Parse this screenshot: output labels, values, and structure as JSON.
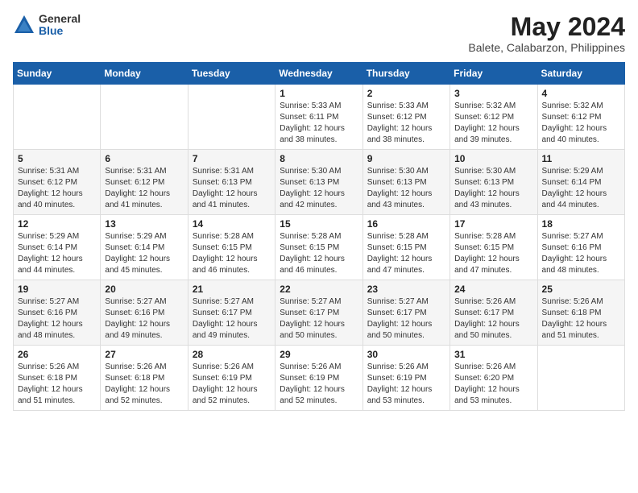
{
  "logo": {
    "general": "General",
    "blue": "Blue"
  },
  "title": {
    "month_year": "May 2024",
    "location": "Balete, Calabarzon, Philippines"
  },
  "weekdays": [
    "Sunday",
    "Monday",
    "Tuesday",
    "Wednesday",
    "Thursday",
    "Friday",
    "Saturday"
  ],
  "weeks": [
    [
      {
        "day": "",
        "info": ""
      },
      {
        "day": "",
        "info": ""
      },
      {
        "day": "",
        "info": ""
      },
      {
        "day": "1",
        "info": "Sunrise: 5:33 AM\nSunset: 6:11 PM\nDaylight: 12 hours\nand 38 minutes."
      },
      {
        "day": "2",
        "info": "Sunrise: 5:33 AM\nSunset: 6:12 PM\nDaylight: 12 hours\nand 38 minutes."
      },
      {
        "day": "3",
        "info": "Sunrise: 5:32 AM\nSunset: 6:12 PM\nDaylight: 12 hours\nand 39 minutes."
      },
      {
        "day": "4",
        "info": "Sunrise: 5:32 AM\nSunset: 6:12 PM\nDaylight: 12 hours\nand 40 minutes."
      }
    ],
    [
      {
        "day": "5",
        "info": "Sunrise: 5:31 AM\nSunset: 6:12 PM\nDaylight: 12 hours\nand 40 minutes."
      },
      {
        "day": "6",
        "info": "Sunrise: 5:31 AM\nSunset: 6:12 PM\nDaylight: 12 hours\nand 41 minutes."
      },
      {
        "day": "7",
        "info": "Sunrise: 5:31 AM\nSunset: 6:13 PM\nDaylight: 12 hours\nand 41 minutes."
      },
      {
        "day": "8",
        "info": "Sunrise: 5:30 AM\nSunset: 6:13 PM\nDaylight: 12 hours\nand 42 minutes."
      },
      {
        "day": "9",
        "info": "Sunrise: 5:30 AM\nSunset: 6:13 PM\nDaylight: 12 hours\nand 43 minutes."
      },
      {
        "day": "10",
        "info": "Sunrise: 5:30 AM\nSunset: 6:13 PM\nDaylight: 12 hours\nand 43 minutes."
      },
      {
        "day": "11",
        "info": "Sunrise: 5:29 AM\nSunset: 6:14 PM\nDaylight: 12 hours\nand 44 minutes."
      }
    ],
    [
      {
        "day": "12",
        "info": "Sunrise: 5:29 AM\nSunset: 6:14 PM\nDaylight: 12 hours\nand 44 minutes."
      },
      {
        "day": "13",
        "info": "Sunrise: 5:29 AM\nSunset: 6:14 PM\nDaylight: 12 hours\nand 45 minutes."
      },
      {
        "day": "14",
        "info": "Sunrise: 5:28 AM\nSunset: 6:15 PM\nDaylight: 12 hours\nand 46 minutes."
      },
      {
        "day": "15",
        "info": "Sunrise: 5:28 AM\nSunset: 6:15 PM\nDaylight: 12 hours\nand 46 minutes."
      },
      {
        "day": "16",
        "info": "Sunrise: 5:28 AM\nSunset: 6:15 PM\nDaylight: 12 hours\nand 47 minutes."
      },
      {
        "day": "17",
        "info": "Sunrise: 5:28 AM\nSunset: 6:15 PM\nDaylight: 12 hours\nand 47 minutes."
      },
      {
        "day": "18",
        "info": "Sunrise: 5:27 AM\nSunset: 6:16 PM\nDaylight: 12 hours\nand 48 minutes."
      }
    ],
    [
      {
        "day": "19",
        "info": "Sunrise: 5:27 AM\nSunset: 6:16 PM\nDaylight: 12 hours\nand 48 minutes."
      },
      {
        "day": "20",
        "info": "Sunrise: 5:27 AM\nSunset: 6:16 PM\nDaylight: 12 hours\nand 49 minutes."
      },
      {
        "day": "21",
        "info": "Sunrise: 5:27 AM\nSunset: 6:17 PM\nDaylight: 12 hours\nand 49 minutes."
      },
      {
        "day": "22",
        "info": "Sunrise: 5:27 AM\nSunset: 6:17 PM\nDaylight: 12 hours\nand 50 minutes."
      },
      {
        "day": "23",
        "info": "Sunrise: 5:27 AM\nSunset: 6:17 PM\nDaylight: 12 hours\nand 50 minutes."
      },
      {
        "day": "24",
        "info": "Sunrise: 5:26 AM\nSunset: 6:17 PM\nDaylight: 12 hours\nand 50 minutes."
      },
      {
        "day": "25",
        "info": "Sunrise: 5:26 AM\nSunset: 6:18 PM\nDaylight: 12 hours\nand 51 minutes."
      }
    ],
    [
      {
        "day": "26",
        "info": "Sunrise: 5:26 AM\nSunset: 6:18 PM\nDaylight: 12 hours\nand 51 minutes."
      },
      {
        "day": "27",
        "info": "Sunrise: 5:26 AM\nSunset: 6:18 PM\nDaylight: 12 hours\nand 52 minutes."
      },
      {
        "day": "28",
        "info": "Sunrise: 5:26 AM\nSunset: 6:19 PM\nDaylight: 12 hours\nand 52 minutes."
      },
      {
        "day": "29",
        "info": "Sunrise: 5:26 AM\nSunset: 6:19 PM\nDaylight: 12 hours\nand 52 minutes."
      },
      {
        "day": "30",
        "info": "Sunrise: 5:26 AM\nSunset: 6:19 PM\nDaylight: 12 hours\nand 53 minutes."
      },
      {
        "day": "31",
        "info": "Sunrise: 5:26 AM\nSunset: 6:20 PM\nDaylight: 12 hours\nand 53 minutes."
      },
      {
        "day": "",
        "info": ""
      }
    ]
  ]
}
